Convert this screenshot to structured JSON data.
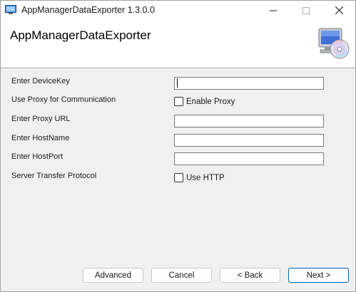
{
  "window": {
    "title": "AppManagerDataExporter 1.3.0.0"
  },
  "banner": {
    "title": "AppManagerDataExporter",
    "icon": "computer-cd-icon"
  },
  "form": {
    "device_key": {
      "label": "Enter DeviceKey",
      "value": ""
    },
    "use_proxy": {
      "label": "Use Proxy for Communication",
      "checkbox_label": "Enable Proxy",
      "checked": false
    },
    "proxy_url": {
      "label": "Enter Proxy URL",
      "value": ""
    },
    "host_name": {
      "label": "Enter HostName",
      "value": ""
    },
    "host_port": {
      "label": "Enter HostPort",
      "value": ""
    },
    "protocol": {
      "label": "Server Transfer Protocol",
      "checkbox_label": "Use HTTP",
      "checked": false
    }
  },
  "buttons": {
    "advanced": "Advanced",
    "cancel": "Cancel",
    "back": "< Back",
    "next": "Next >"
  },
  "colors": {
    "accent": "#0067c0"
  }
}
